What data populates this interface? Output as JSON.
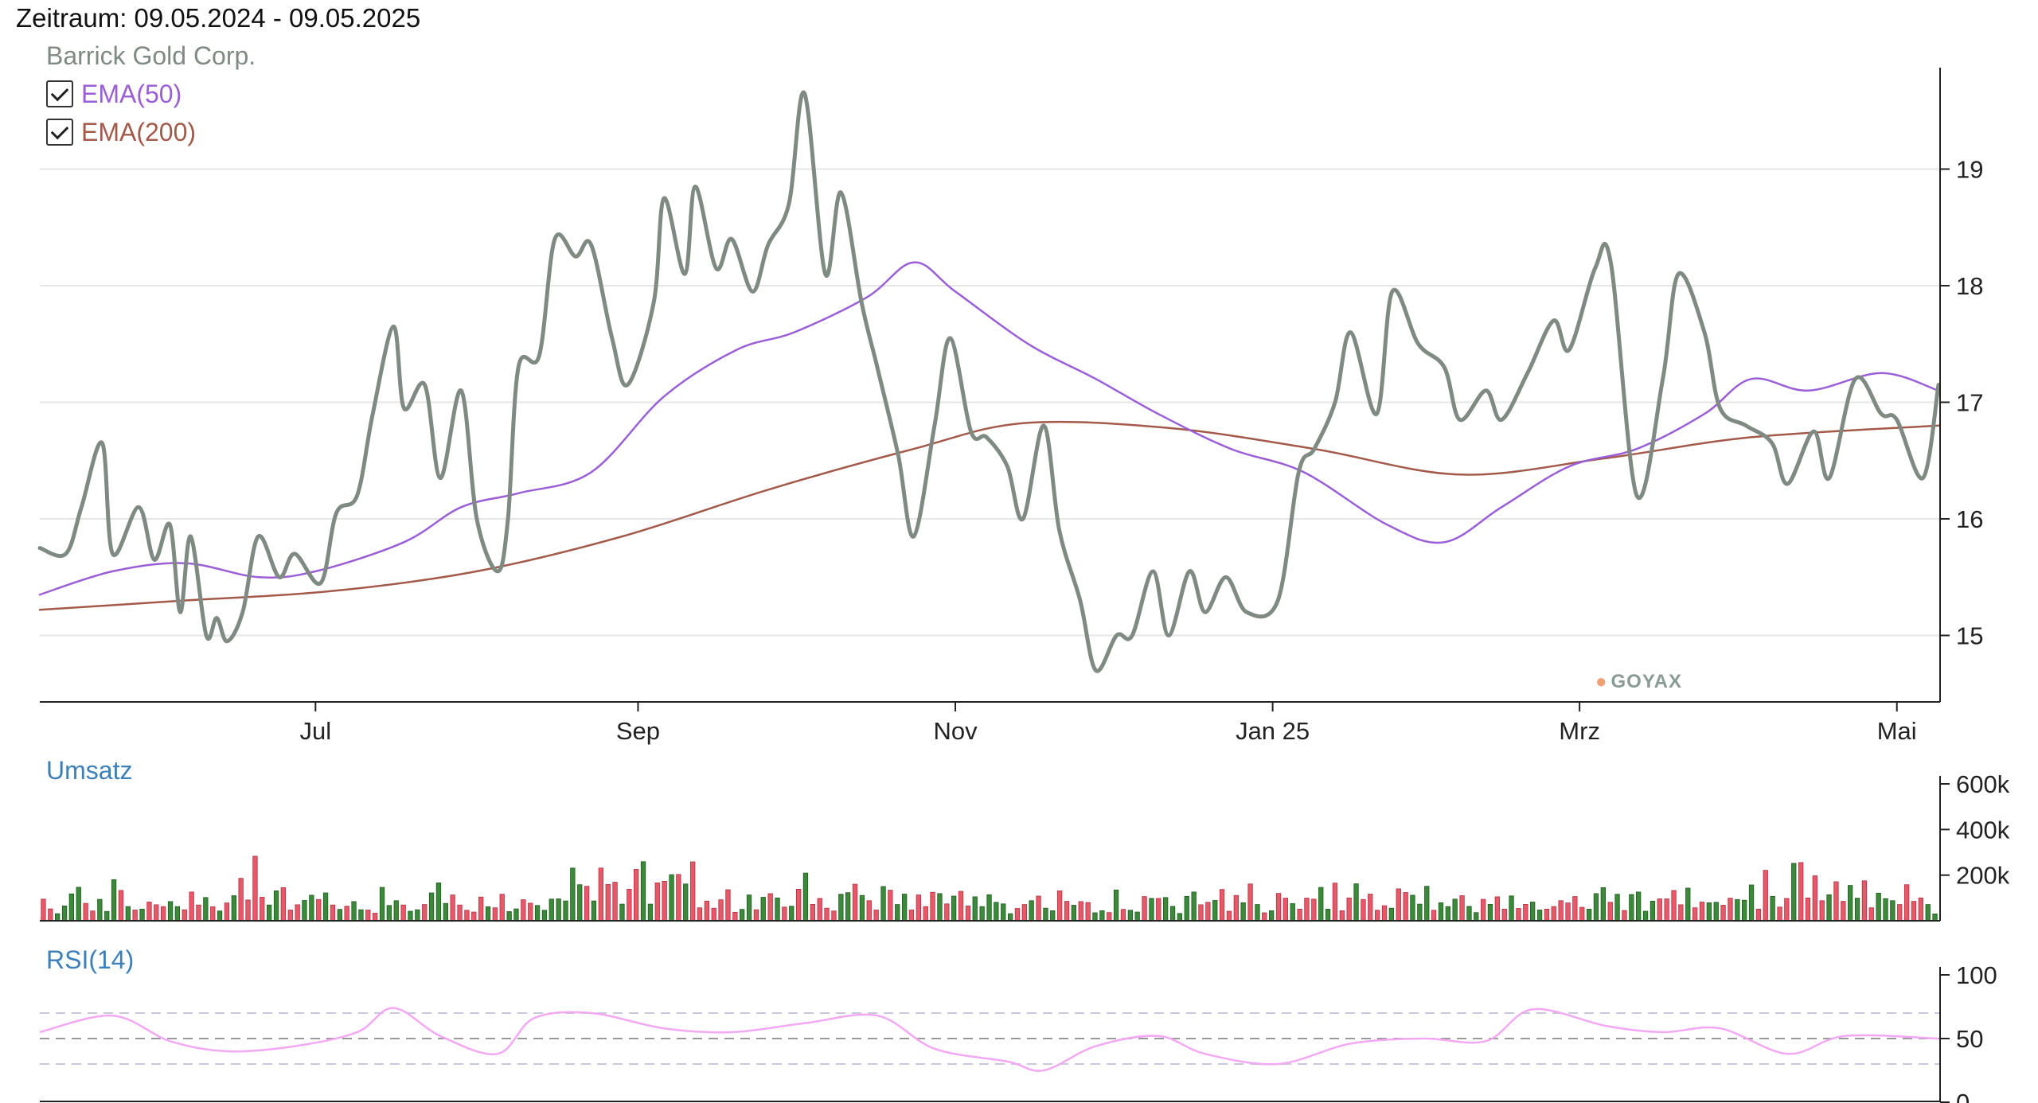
{
  "header": {
    "period_label": "Zeitraum: 09.05.2024 - 09.05.2025"
  },
  "legend": {
    "instrument": "Barrick Gold Corp.",
    "ema50_label": "EMA(50)",
    "ema200_label": "EMA(200)"
  },
  "panels": {
    "volume_label": "Umsatz",
    "rsi_label": "RSI(14)"
  },
  "logo": {
    "text": "GOYAX"
  },
  "colors": {
    "price": "#7f8a82",
    "ema50": "#9a5fd6",
    "ema200": "#a35a4b",
    "volume_up": "#3a8a3a",
    "volume_down": "#e85868",
    "rsi": "#f3a8f3",
    "grid": "#e6e6e6"
  },
  "chart_data": [
    {
      "type": "line",
      "title": "Barrick Gold Corp.",
      "x_ticks": [
        "Jul",
        "Sep",
        "Nov",
        "Jan 25",
        "Mrz",
        "Mai"
      ],
      "x_range": [
        "2024-05-09",
        "2025-05-09"
      ],
      "y_ticks": [
        15,
        16,
        17,
        18,
        19
      ],
      "ylim": [
        14.43,
        19.87
      ],
      "grid": true,
      "series": [
        {
          "name": "Barrick Gold Corp.",
          "key": "price",
          "x": [
            "2024-05-09",
            "2024-05-14",
            "2024-05-17",
            "2024-05-21",
            "2024-05-23",
            "2024-05-28",
            "2024-05-31",
            "2024-06-03",
            "2024-06-05",
            "2024-06-07",
            "2024-06-10",
            "2024-06-12",
            "2024-06-14",
            "2024-06-17",
            "2024-06-20",
            "2024-06-24",
            "2024-06-27",
            "2024-07-02",
            "2024-07-05",
            "2024-07-09",
            "2024-07-12",
            "2024-07-16",
            "2024-07-18",
            "2024-07-22",
            "2024-07-25",
            "2024-07-29",
            "2024-08-01",
            "2024-08-05",
            "2024-08-07",
            "2024-08-09",
            "2024-08-13",
            "2024-08-16",
            "2024-08-20",
            "2024-08-23",
            "2024-08-27",
            "2024-08-30",
            "2024-09-04",
            "2024-09-06",
            "2024-09-10",
            "2024-09-12",
            "2024-09-16",
            "2024-09-19",
            "2024-09-23",
            "2024-09-26",
            "2024-09-30",
            "2024-10-03",
            "2024-10-07",
            "2024-10-10",
            "2024-10-14",
            "2024-10-17",
            "2024-10-21",
            "2024-10-24",
            "2024-10-28",
            "2024-10-31",
            "2024-11-04",
            "2024-11-07",
            "2024-11-11",
            "2024-11-14",
            "2024-11-18",
            "2024-11-21",
            "2024-11-25",
            "2024-11-28",
            "2024-12-02",
            "2024-12-05",
            "2024-12-09",
            "2024-12-12",
            "2024-12-16",
            "2024-12-19",
            "2024-12-23",
            "2024-12-27",
            "2025-01-02",
            "2025-01-06",
            "2025-01-09",
            "2025-01-13",
            "2025-01-16",
            "2025-01-21",
            "2025-01-24",
            "2025-01-29",
            "2025-02-03",
            "2025-02-06",
            "2025-02-11",
            "2025-02-14",
            "2025-02-19",
            "2025-02-24",
            "2025-02-27",
            "2025-03-04",
            "2025-03-07",
            "2025-03-12",
            "2025-03-17",
            "2025-03-20",
            "2025-03-25",
            "2025-03-28",
            "2025-04-02",
            "2025-04-07",
            "2025-04-10",
            "2025-04-15",
            "2025-04-18",
            "2025-04-23",
            "2025-04-28",
            "2025-05-01",
            "2025-05-06",
            "2025-05-09"
          ],
          "y": [
            15.75,
            15.7,
            16.1,
            16.65,
            15.7,
            16.1,
            15.65,
            15.95,
            15.2,
            15.85,
            15.0,
            15.15,
            14.95,
            15.2,
            15.85,
            15.5,
            15.7,
            15.45,
            16.05,
            16.2,
            16.9,
            17.65,
            16.95,
            17.15,
            16.35,
            17.1,
            16.0,
            15.55,
            16.0,
            17.3,
            17.4,
            18.4,
            18.25,
            18.35,
            17.55,
            17.15,
            17.85,
            18.75,
            18.1,
            18.85,
            18.15,
            18.4,
            17.95,
            18.35,
            18.7,
            19.65,
            18.1,
            18.8,
            17.85,
            17.3,
            16.55,
            15.85,
            16.8,
            17.55,
            16.75,
            16.7,
            16.45,
            16.0,
            16.8,
            15.9,
            15.3,
            14.7,
            15.0,
            15.0,
            15.55,
            15.0,
            15.55,
            15.2,
            15.5,
            15.2,
            15.3,
            16.4,
            16.6,
            17.0,
            17.6,
            16.9,
            17.95,
            17.5,
            17.3,
            16.85,
            17.1,
            16.85,
            17.25,
            17.7,
            17.45,
            18.15,
            18.2,
            16.2,
            17.2,
            18.1,
            17.6,
            16.95,
            16.8,
            16.65,
            16.3,
            16.75,
            16.35,
            17.2,
            16.9,
            16.85,
            16.35,
            17.15
          ]
        },
        {
          "name": "EMA(50)",
          "key": "ema50",
          "x": [
            "2024-05-09",
            "2024-05-23",
            "2024-06-06",
            "2024-06-20",
            "2024-07-01",
            "2024-07-18",
            "2024-07-29",
            "2024-08-09",
            "2024-08-23",
            "2024-09-06",
            "2024-09-20",
            "2024-10-01",
            "2024-10-15",
            "2024-10-24",
            "2024-11-01",
            "2024-11-15",
            "2024-11-28",
            "2024-12-10",
            "2024-12-24",
            "2025-01-07",
            "2025-01-23",
            "2025-02-03",
            "2025-02-14",
            "2025-02-27",
            "2025-03-12",
            "2025-03-25",
            "2025-04-03",
            "2025-04-14",
            "2025-04-28",
            "2025-05-09"
          ],
          "y": [
            15.35,
            15.55,
            15.62,
            15.5,
            15.55,
            15.8,
            16.1,
            16.22,
            16.4,
            17.05,
            17.45,
            17.6,
            17.9,
            18.2,
            17.95,
            17.5,
            17.2,
            16.9,
            16.6,
            16.4,
            15.95,
            15.8,
            16.1,
            16.45,
            16.6,
            16.9,
            17.2,
            17.1,
            17.25,
            17.1
          ]
        },
        {
          "name": "EMA(200)",
          "key": "ema200",
          "x": [
            "2024-05-09",
            "2024-06-06",
            "2024-07-04",
            "2024-08-01",
            "2024-08-29",
            "2024-09-26",
            "2024-10-24",
            "2024-11-14",
            "2024-12-12",
            "2025-01-09",
            "2025-02-06",
            "2025-03-06",
            "2025-04-03",
            "2025-05-09"
          ],
          "y": [
            15.22,
            15.3,
            15.38,
            15.55,
            15.85,
            16.25,
            16.6,
            16.82,
            16.78,
            16.6,
            16.38,
            16.52,
            16.7,
            16.8
          ]
        }
      ]
    },
    {
      "type": "bar",
      "title": "Umsatz",
      "y_ticks": [
        "200k",
        "400k",
        "600k"
      ],
      "ylim": [
        0,
        600000
      ],
      "start": "2024-05-09",
      "end": "2025-05-09",
      "volumes": [
        95000,
        52000,
        31000,
        65000,
        118000,
        147000,
        76000,
        43000,
        94000,
        41000,
        180000,
        133000,
        62000,
        47000,
        51000,
        82000,
        70000,
        62000,
        84000,
        62000,
        48000,
        126000,
        69000,
        102000,
        61000,
        43000,
        78000,
        110000,
        186000,
        91000,
        283000,
        103000,
        69000,
        131000,
        145000,
        47000,
        70000,
        89000,
        112000,
        93000,
        122000,
        69000,
        50000,
        64000,
        84000,
        48000,
        47000,
        33000,
        146000,
        67000,
        88000,
        69000,
        42000,
        48000,
        71000,
        122000,
        166000,
        76000,
        113000,
        69000,
        46000,
        38000,
        104000,
        61000,
        57000,
        116000,
        40000,
        52000,
        92000,
        77000,
        67000,
        46000,
        95000,
        96000,
        87000,
        231000,
        158000,
        151000,
        87000,
        231000,
        159000,
        169000,
        73000,
        138000,
        225000,
        259000,
        73000,
        166000,
        173000,
        202000,
        203000,
        161000,
        258000,
        57000,
        86000,
        55000,
        92000,
        136000,
        37000,
        50000,
        113000,
        48000,
        103000,
        119000,
        100000,
        60000,
        64000,
        138000,
        209000,
        72000,
        98000,
        55000,
        43000,
        116000,
        123000,
        160000,
        111000,
        88000,
        47000,
        150000,
        134000,
        71000,
        117000,
        47000,
        113000,
        62000,
        125000,
        119000,
        74000,
        108000,
        129000,
        65000,
        105000,
        62000,
        114000,
        81000,
        74000,
        31000,
        54000,
        71000,
        88000,
        108000,
        55000,
        44000,
        131000,
        85000,
        68000,
        84000,
        80000,
        35000,
        44000,
        36000,
        135000,
        50000,
        46000,
        38000,
        106000,
        98000,
        98000,
        102000,
        63000,
        32000,
        107000,
        126000,
        70000,
        81000,
        89000,
        137000,
        42000,
        111000,
        79000,
        161000,
        71000,
        35000,
        44000,
        120000,
        99000,
        75000,
        51000,
        99000,
        95000,
        146000,
        51000,
        165000,
        44000,
        100000,
        162000,
        93000,
        117000,
        46000,
        66000,
        55000,
        140000,
        124000,
        112000,
        73000,
        151000,
        46000,
        79000,
        62000,
        95000,
        110000,
        63000,
        36000,
        94000,
        72000,
        105000,
        51000,
        109000,
        54000,
        72000,
        82000,
        47000,
        51000,
        62000,
        88000,
        78000,
        106000,
        59000,
        51000,
        119000,
        145000,
        81000,
        116000,
        45000,
        115000,
        126000,
        42000,
        86000,
        96000,
        96000,
        133000,
        70000,
        143000,
        57000,
        82000,
        79000,
        81000,
        68000,
        99000,
        93000,
        90000,
        157000,
        51000,
        221000,
        107000,
        60000,
        98000,
        252000,
        255000,
        100000,
        197000,
        88000,
        114000,
        171000,
        85000,
        155000,
        99000,
        175000,
        57000,
        121000,
        97000,
        88000,
        71000,
        158000,
        85000,
        100000,
        71000,
        30000
      ],
      "up": [
        false,
        false,
        true,
        true,
        true,
        true,
        false,
        false,
        true,
        true,
        true,
        false,
        true,
        false,
        true,
        false,
        false,
        false,
        true,
        true,
        false,
        false,
        false,
        true,
        false,
        true,
        false,
        true,
        false,
        false,
        false,
        false,
        true,
        true,
        false,
        false,
        false,
        true,
        true,
        false,
        true,
        false,
        true,
        false,
        true,
        true,
        false,
        false,
        true,
        true,
        true,
        false,
        true,
        true,
        false,
        true,
        true,
        true,
        false,
        false,
        false,
        false,
        false,
        true,
        false,
        false,
        true,
        true,
        false,
        false,
        true,
        true,
        true,
        true,
        true,
        true,
        true,
        false,
        true,
        false,
        false,
        false,
        true,
        false,
        false,
        true,
        true,
        false,
        false,
        true,
        false,
        true,
        false,
        false,
        false,
        false,
        false,
        false,
        false,
        true,
        true,
        false,
        true,
        false,
        true,
        false,
        true,
        false,
        true,
        false,
        false,
        false,
        false,
        true,
        true,
        false,
        true,
        false,
        false,
        true,
        false,
        true,
        true,
        false,
        false,
        false,
        false,
        true,
        false,
        true,
        false,
        false,
        true,
        true,
        true,
        true,
        true,
        true,
        false,
        false,
        true,
        false,
        true,
        true,
        false,
        false,
        true,
        false,
        false,
        true,
        true,
        false,
        true,
        false,
        true,
        true,
        false,
        true,
        false,
        true,
        true,
        true,
        true,
        true,
        false,
        false,
        true,
        false,
        false,
        false,
        true,
        false,
        true,
        false,
        true,
        false,
        false,
        true,
        false,
        false,
        false,
        true,
        true,
        false,
        false,
        false,
        true,
        false,
        false,
        false,
        false,
        true,
        false,
        false,
        true,
        true,
        true,
        false,
        true,
        true,
        true,
        false,
        true,
        true,
        false,
        true,
        false,
        false,
        true,
        false,
        false,
        true,
        true,
        false,
        false,
        false,
        false,
        false,
        false,
        true,
        true,
        true,
        false,
        true,
        false,
        true,
        true,
        true,
        true,
        false,
        false,
        false,
        false,
        true,
        false,
        false,
        true,
        true,
        false,
        false,
        true,
        true,
        true,
        false,
        false,
        true,
        false,
        false,
        true,
        false,
        false,
        false,
        false,
        true,
        false,
        false,
        true,
        true,
        false,
        false,
        true,
        true,
        true,
        false,
        false,
        false,
        false,
        true,
        true,
        true,
        true,
        true,
        true,
        false,
        true,
        true,
        false,
        false,
        false,
        true,
        false,
        false
      ]
    },
    {
      "type": "line",
      "title": "RSI(14)",
      "y_ticks": [
        0,
        50,
        100
      ],
      "ylim": [
        0,
        100
      ],
      "reference_lines": [
        30,
        50,
        70
      ],
      "series": [
        {
          "name": "RSI(14)",
          "key": "rsi",
          "x": [
            "2024-05-09",
            "2024-05-23",
            "2024-06-03",
            "2024-06-14",
            "2024-06-27",
            "2024-07-09",
            "2024-07-16",
            "2024-07-25",
            "2024-08-05",
            "2024-08-12",
            "2024-08-23",
            "2024-09-06",
            "2024-09-19",
            "2024-10-03",
            "2024-10-17",
            "2024-10-28",
            "2024-11-11",
            "2024-11-18",
            "2024-11-28",
            "2024-12-10",
            "2024-12-19",
            "2025-01-02",
            "2025-01-16",
            "2025-01-30",
            "2025-02-11",
            "2025-02-20",
            "2025-03-06",
            "2025-03-17",
            "2025-03-28",
            "2025-04-10",
            "2025-04-21",
            "2025-05-09"
          ],
          "y": [
            55,
            68,
            48,
            40,
            44,
            55,
            74,
            52,
            38,
            66,
            70,
            58,
            55,
            62,
            68,
            42,
            32,
            25,
            44,
            52,
            38,
            30,
            46,
            50,
            48,
            73,
            60,
            55,
            58,
            38,
            52,
            50
          ]
        }
      ]
    }
  ]
}
